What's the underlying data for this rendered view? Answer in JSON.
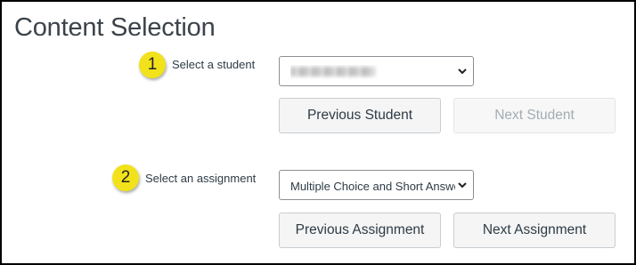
{
  "page": {
    "title": "Content Selection"
  },
  "student_section": {
    "step_number": "1",
    "label": "Select a student",
    "selected_value": "",
    "selected_value_redacted": true,
    "previous_button": "Previous Student",
    "next_button": "Next Student",
    "next_disabled": true
  },
  "assignment_section": {
    "step_number": "2",
    "label": "Select an assignment",
    "selected_value": "Multiple Choice and Short Answer",
    "previous_button": "Previous Assignment",
    "next_button": "Next Assignment"
  },
  "colors": {
    "badge": "#f2e21b",
    "text": "#2d3b45",
    "button_bg": "#f5f5f5",
    "disabled_text": "#a3acb3"
  },
  "icons": {
    "dropdown": "chevron-down-icon"
  }
}
